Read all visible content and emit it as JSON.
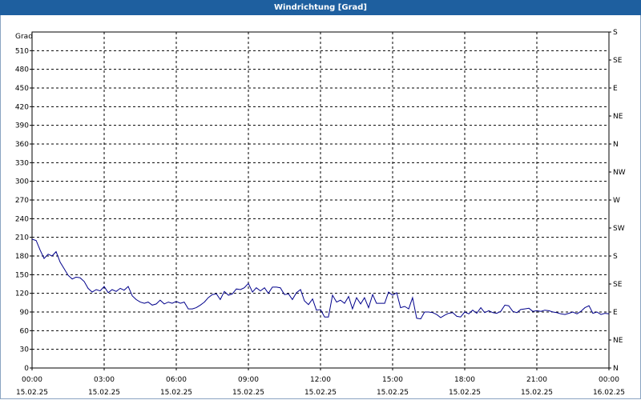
{
  "window": {
    "title": "Windrichtung [Grad]"
  },
  "chart_data": {
    "type": "line",
    "title": "Windrichtung [Grad]",
    "ylabel": "Grad",
    "xlabel": "",
    "ylim": [
      0,
      540
    ],
    "grid": true,
    "line_color": "#00008b",
    "y_ticks": [
      0,
      30,
      60,
      90,
      120,
      150,
      180,
      210,
      240,
      270,
      300,
      330,
      360,
      390,
      420,
      450,
      480,
      510
    ],
    "right_ticks": [
      {
        "value": 0,
        "label": "N"
      },
      {
        "value": 45,
        "label": "NE"
      },
      {
        "value": 90,
        "label": "E"
      },
      {
        "value": 135,
        "label": "SE"
      },
      {
        "value": 180,
        "label": "S"
      },
      {
        "value": 225,
        "label": "SW"
      },
      {
        "value": 270,
        "label": "W"
      },
      {
        "value": 315,
        "label": "NW"
      },
      {
        "value": 360,
        "label": "N"
      },
      {
        "value": 405,
        "label": "NE"
      },
      {
        "value": 450,
        "label": "E"
      },
      {
        "value": 495,
        "label": "SE"
      },
      {
        "value": 540,
        "label": "S"
      }
    ],
    "x_ticks": [
      {
        "hour": 0,
        "time": "00:00",
        "date": "15.02.25"
      },
      {
        "hour": 3,
        "time": "03:00",
        "date": "15.02.25"
      },
      {
        "hour": 6,
        "time": "06:00",
        "date": "15.02.25"
      },
      {
        "hour": 9,
        "time": "09:00",
        "date": "15.02.25"
      },
      {
        "hour": 12,
        "time": "12:00",
        "date": "15.02.25"
      },
      {
        "hour": 15,
        "time": "15:00",
        "date": "15.02.25"
      },
      {
        "hour": 18,
        "time": "18:00",
        "date": "15.02.25"
      },
      {
        "hour": 21,
        "time": "21:00",
        "date": "15.02.25"
      },
      {
        "hour": 24,
        "time": "00:00",
        "date": "16.02.25"
      }
    ],
    "xlim_hours": [
      0,
      24
    ],
    "series": [
      {
        "points": [
          [
            0.0,
            207
          ],
          [
            0.17,
            205
          ],
          [
            0.33,
            190
          ],
          [
            0.5,
            176
          ],
          [
            0.67,
            183
          ],
          [
            0.83,
            180
          ],
          [
            1.0,
            187
          ],
          [
            1.17,
            170
          ],
          [
            1.33,
            160
          ],
          [
            1.5,
            149
          ],
          [
            1.67,
            143
          ],
          [
            1.83,
            146
          ],
          [
            2.0,
            145
          ],
          [
            2.17,
            139
          ],
          [
            2.33,
            128
          ],
          [
            2.5,
            122
          ],
          [
            2.67,
            126
          ],
          [
            2.83,
            124
          ],
          [
            3.0,
            131
          ],
          [
            3.17,
            121
          ],
          [
            3.33,
            126
          ],
          [
            3.5,
            123
          ],
          [
            3.67,
            128
          ],
          [
            3.83,
            125
          ],
          [
            4.0,
            131
          ],
          [
            4.17,
            116
          ],
          [
            4.33,
            110
          ],
          [
            4.5,
            106
          ],
          [
            4.67,
            104
          ],
          [
            4.83,
            106
          ],
          [
            5.0,
            101
          ],
          [
            5.17,
            103
          ],
          [
            5.33,
            109
          ],
          [
            5.5,
            103
          ],
          [
            5.67,
            106
          ],
          [
            5.83,
            104
          ],
          [
            6.0,
            107
          ],
          [
            6.17,
            104
          ],
          [
            6.33,
            106
          ],
          [
            6.5,
            95
          ],
          [
            6.67,
            95
          ],
          [
            6.83,
            97
          ],
          [
            7.0,
            101
          ],
          [
            7.17,
            106
          ],
          [
            7.33,
            113
          ],
          [
            7.5,
            118
          ],
          [
            7.67,
            119
          ],
          [
            7.83,
            110
          ],
          [
            8.0,
            123
          ],
          [
            8.17,
            117
          ],
          [
            8.33,
            119
          ],
          [
            8.5,
            127
          ],
          [
            8.67,
            126
          ],
          [
            8.83,
            129
          ],
          [
            9.0,
            136
          ],
          [
            9.17,
            122
          ],
          [
            9.33,
            129
          ],
          [
            9.5,
            124
          ],
          [
            9.67,
            129
          ],
          [
            9.83,
            120
          ],
          [
            10.0,
            130
          ],
          [
            10.17,
            130
          ],
          [
            10.33,
            129
          ],
          [
            10.5,
            118
          ],
          [
            10.67,
            119
          ],
          [
            10.83,
            110
          ],
          [
            11.0,
            121
          ],
          [
            11.17,
            126
          ],
          [
            11.33,
            108
          ],
          [
            11.5,
            102
          ],
          [
            11.67,
            111
          ],
          [
            11.83,
            93
          ],
          [
            12.0,
            94
          ],
          [
            12.17,
            82
          ],
          [
            12.33,
            82
          ],
          [
            12.5,
            117
          ],
          [
            12.67,
            106
          ],
          [
            12.83,
            109
          ],
          [
            13.0,
            104
          ],
          [
            13.17,
            115
          ],
          [
            13.33,
            95
          ],
          [
            13.5,
            113
          ],
          [
            13.67,
            103
          ],
          [
            13.83,
            113
          ],
          [
            14.0,
            97
          ],
          [
            14.17,
            118
          ],
          [
            14.33,
            104
          ],
          [
            14.5,
            104
          ],
          [
            14.67,
            104
          ],
          [
            14.83,
            122
          ],
          [
            15.0,
            117
          ],
          [
            15.17,
            121
          ],
          [
            15.33,
            97
          ],
          [
            15.5,
            99
          ],
          [
            15.67,
            95
          ],
          [
            15.83,
            113
          ],
          [
            16.0,
            80
          ],
          [
            16.17,
            79
          ],
          [
            16.33,
            90
          ],
          [
            16.5,
            90
          ],
          [
            16.67,
            89
          ],
          [
            16.83,
            86
          ],
          [
            17.0,
            81
          ],
          [
            17.17,
            85
          ],
          [
            17.33,
            88
          ],
          [
            17.5,
            89
          ],
          [
            17.67,
            83
          ],
          [
            17.83,
            82
          ],
          [
            18.0,
            90
          ],
          [
            18.17,
            87
          ],
          [
            18.33,
            93
          ],
          [
            18.5,
            88
          ],
          [
            18.67,
            97
          ],
          [
            18.83,
            89
          ],
          [
            19.0,
            92
          ],
          [
            19.17,
            89
          ],
          [
            19.33,
            88
          ],
          [
            19.5,
            91
          ],
          [
            19.67,
            101
          ],
          [
            19.83,
            100
          ],
          [
            20.0,
            91
          ],
          [
            20.17,
            89
          ],
          [
            20.33,
            94
          ],
          [
            20.5,
            95
          ],
          [
            20.67,
            96
          ],
          [
            20.83,
            91
          ],
          [
            21.0,
            92
          ],
          [
            21.17,
            91
          ],
          [
            21.33,
            93
          ],
          [
            21.5,
            92
          ],
          [
            21.67,
            90
          ],
          [
            21.83,
            89
          ],
          [
            22.0,
            87
          ],
          [
            22.17,
            86
          ],
          [
            22.33,
            88
          ],
          [
            22.5,
            90
          ],
          [
            22.67,
            87
          ],
          [
            22.83,
            91
          ],
          [
            23.0,
            97
          ],
          [
            23.17,
            100
          ],
          [
            23.33,
            88
          ],
          [
            23.5,
            90
          ],
          [
            23.67,
            86
          ],
          [
            23.83,
            88
          ],
          [
            24.0,
            87
          ]
        ]
      }
    ]
  }
}
